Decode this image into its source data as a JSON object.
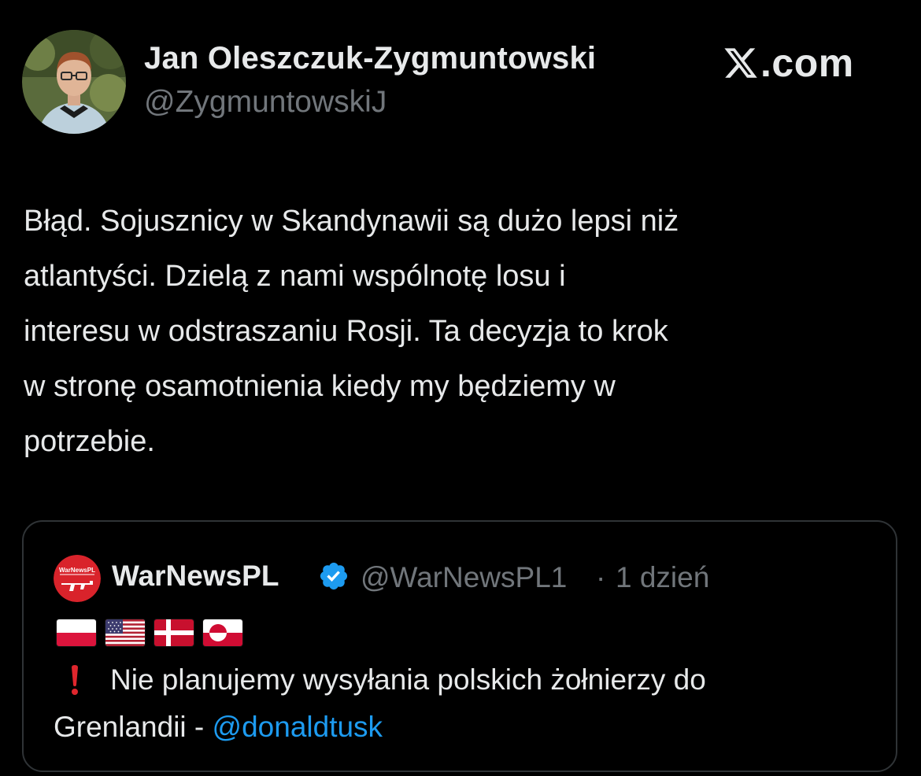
{
  "author": {
    "display_name": "Jan Oleszczuk-Zygmuntowski",
    "handle": "@ZygmuntowskiJ"
  },
  "brand": {
    "text": ".com"
  },
  "tweet": {
    "lines": [
      "Błąd. Sojusznicy w Skandynawii są dużo lepsi niż",
      "atlantyści. Dzielą z nami wspólnotę losu i",
      "interesu w odstraszaniu Rosji. Ta decyzja to krok",
      "w stronę osamotnienia kiedy my będziemy w",
      "potrzebie."
    ]
  },
  "quoted": {
    "avatar_text": "WarNewsPL",
    "name": "WarNewsPL",
    "handle": "@WarNewsPL1",
    "separator": "·",
    "time": "1 dzień",
    "flags": [
      "poland-flag-icon",
      "usa-flag-icon",
      "denmark-flag-icon",
      "greenland-flag-icon"
    ],
    "text_line1": "Nie planujemy wysyłania polskich żołnierzy do",
    "text_line2_prefix": "Grenlandii - ",
    "mention": "@donaldtusk"
  },
  "colors": {
    "background": "#000000",
    "text": "#e7e9ea",
    "secondary": "#71767b",
    "link": "#1d9bf0",
    "border": "#2f3336",
    "verified": "#1d9bf0",
    "alert": "#e0262d"
  }
}
